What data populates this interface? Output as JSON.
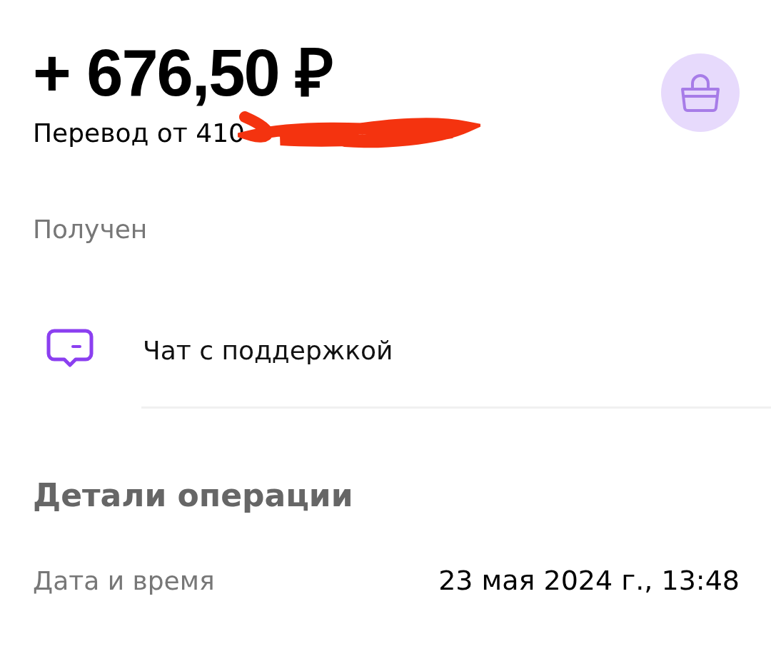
{
  "amount": "+ 676,50 ₽",
  "description": "Перевод от 410",
  "status": "Получен",
  "support": {
    "label": "Чат с поддержкой"
  },
  "details": {
    "title": "Детали операции",
    "rows": [
      {
        "label": "Дата и время",
        "value": "23 мая 2024 г., 13:48"
      }
    ]
  }
}
